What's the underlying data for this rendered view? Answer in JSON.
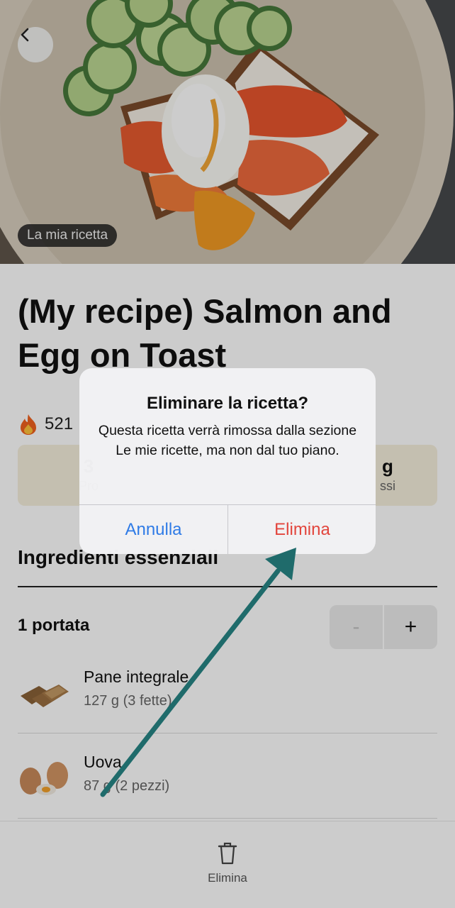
{
  "hero": {
    "badge": "La mia ricetta",
    "back_icon": "chevron-left-icon"
  },
  "recipe": {
    "title": "(My recipe) Salmon and Egg on Toast",
    "calories_icon": "fire-icon",
    "calories_partial": "521",
    "macros_partial": [
      {
        "value": "3",
        "label": "Pro"
      },
      {
        "value": "g",
        "label": "ssi"
      }
    ]
  },
  "ingredients": {
    "section_title": "Ingredienti essenziali",
    "servings_label": "1 portata",
    "stepper": {
      "minus": "-",
      "plus": "+"
    },
    "items": [
      {
        "name": "Pane integrale",
        "qty": "127 g (3 fette)"
      },
      {
        "name": "Uova",
        "qty": "87 g (2 pezzi)"
      }
    ]
  },
  "bottom_bar": {
    "delete_label": "Elimina",
    "delete_icon": "trash-icon"
  },
  "alert": {
    "title": "Eliminare la ricetta?",
    "message": "Questa ricetta verrà rimossa dalla sezione Le mie ricette, ma non dal tuo piano.",
    "cancel_label": "Annulla",
    "delete_label": "Elimina"
  },
  "colors": {
    "cancel": "#2f7be6",
    "destructive": "#e2453c",
    "annotation_arrow": "#1f6b6b",
    "macro_bg": "#f6efdd"
  }
}
